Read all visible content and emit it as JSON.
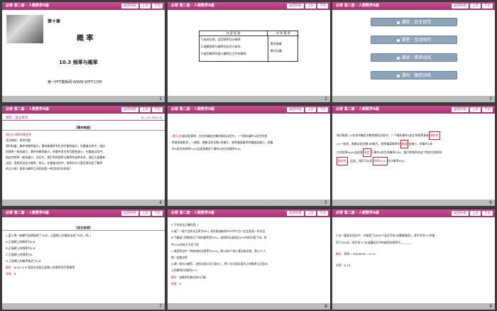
{
  "header": {
    "title": "必修 第二册 · 人教数学A版",
    "nav": "返回导航",
    "up": "上页",
    "down": "下页"
  },
  "slide1": {
    "chapter": "第十章",
    "title": "概 率",
    "section": "10.3 频率与概率",
    "site": "第一PPT模板网-WWW.1PPT.COM"
  },
  "slide2": {
    "table": {
      "col1": "内 容 标 准",
      "col2": "学 科 素 养",
      "rows": [
        "1.结合实例，会用频率估计概率.",
        "2.理解频率与概率的区别与联系.",
        "3.能用概率的意义解释生活中的事例."
      ],
      "literacy": [
        "数学抽象",
        "数学运算"
      ]
    }
  },
  "slide3": {
    "menu": [
      "课前 · 自主探究",
      "课堂 · 互动探究",
      "课后 · 素养培优",
      "课时 · 跟踪训练"
    ]
  },
  "slide4": {
    "bar": "课前 · 自主探究",
    "barright": "核心体系  基础达标",
    "box": "[教材梳理]",
    "lines": [
      "知识点  频率的稳定性",
      "读分教材，思考问题",
      "我们知道，事件的概率越大，意味着事件发生的可能性越大，在重复试验中，相应",
      "的频率一般也越大；事件的概率越小，则事件发生的可能性越小，在重复试验中，",
      "相应的频率一般也越小，在初中，我们利用频率与概率的这种关系，通过大量重复",
      "试验，用频率去估计概率，那么，在重复试验中，频率的大小是否就决定了概率",
      "的大小呢？频率与概率之间到底是一种怎样的关系呢？"
    ]
  },
  "slide5": {
    "label": "[提示]",
    "lines": [
      "大量试验表明，在任何确定次数的随机试验中，一个随机事件A发生的频",
      "率具有随机性，一般地，随着试验次数n的增大，频率偏离概率的幅度会缩小，即事",
      "件A发生的频率fn(A)会逐渐稳定于事件A发生的概率P(A)."
    ]
  },
  "slide6": {
    "lines": [
      "知识梳理  (1)在任何确定次数的随机试验中，一个随机事件A发生的频率具有",
      "(2)一般地，随着试验次数n的增大，频率偏离概率的",
      "会缩小，即事件A发",
      "生的频率fn(A)会逐渐",
      "于事件A发生的概率P(A)，我们称频率的这个性质为频率的",
      "，因此，我们可以用",
      "估计概率P(A)."
    ],
    "blanks": [
      "随机性",
      "幅度",
      "稳定",
      "稳定性",
      "频率fn(A)"
    ]
  },
  "slide7": {
    "box": "[自主检测]",
    "q": "1.某人将一枚硬币连掷抛两了10次，正面朝上的情形出现了6次，则(    )",
    "opts": [
      "A.正面朝上的概率为0.6",
      "B.正面朝上的频率为0.6",
      "C.正面朝上的频率为6",
      "D.正面朝上的概率接近于0.6"
    ],
    "ans_label": "解析：",
    "ans": "6/10=0.6 是此次试验正面朝上的频率而不是概率.",
    "key_label": "答案：",
    "key": "B"
  },
  "slide8": {
    "lines": [
      "2.下列说法正确的是(    )",
      "A.某厂一批产品的次品率为8%，则任意抽取其中20件产品一定会发现一件次品",
      "B.气象部门预报明天下雨的概率是90%，说明明天该地区90%的地方要下雨，其",
      "余10%的地方不会下雨",
      "C.某医院治疗一种疾病的治愈率为10%，那么前9个病人都没有治愈，第10个人",
      "就一定能治愈",
      "D.掷一枚均匀硬币，连续出现5次正面向上，第六次出现反面向上的概率与正面向",
      "上的概率仍然都为0.5"
    ],
    "ans_label": "解析：",
    "ans": "由概率的概念知D正确.",
    "key_label": "答案：",
    "key": "D"
  },
  "slide9": {
    "q": [
      "3.在一篇英文短文中，共使用了6000个英文字母(含重复使用)，其中字母\"e\"共使",
      "用了900次，则字母\"e\"在该篇短文中的使用的频率为________."
    ],
    "ans_label": "解析：",
    "ans": "频率= 900/6000 =0.15.",
    "key_label": "答案：",
    "key": "0.15"
  },
  "pages": [
    "1",
    "2",
    "3",
    "4",
    "5",
    "6",
    "7",
    "8",
    "9"
  ]
}
